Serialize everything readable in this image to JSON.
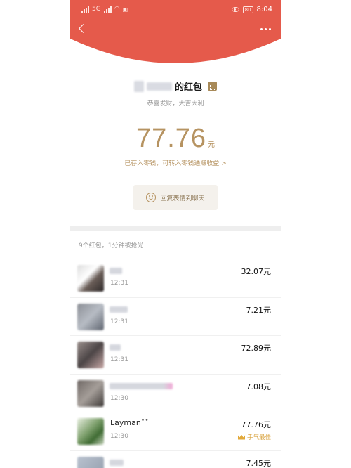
{
  "status_bar": {
    "left_text": "5G",
    "battery": "80",
    "time": "8:04",
    "icons": [
      "signal-icon",
      "wifi-icon",
      "eye-icon",
      "battery-icon"
    ]
  },
  "header": {
    "color": "#e55a4b",
    "back_icon": "chevron-left-icon",
    "more_icon": "more-icon"
  },
  "envelope": {
    "sender_suffix": "的红包",
    "greeting": "恭喜发财，大吉大利",
    "amount": "77.76",
    "unit": "元",
    "saved_link": "已存入零钱，可转入零钱通赚收益 >",
    "reply_label": "回复表情到聊天"
  },
  "summary": "9个红包，1分钟被抢光",
  "recipients": [
    {
      "time": "12:31",
      "amount": "32.07元",
      "best": ""
    },
    {
      "time": "12:31",
      "amount": "7.21元",
      "best": ""
    },
    {
      "time": "12:31",
      "amount": "72.89元",
      "best": ""
    },
    {
      "time": "12:30",
      "amount": "7.08元",
      "best": ""
    },
    {
      "name": "Layman˚˚",
      "time": "12:30",
      "amount": "77.76元",
      "best": "手气最佳"
    },
    {
      "time": "",
      "amount": "7.45元",
      "best": ""
    }
  ],
  "colors": {
    "accent_gold": "#b69361",
    "header_red": "#e55a4b",
    "best_gold": "#d9a441"
  }
}
